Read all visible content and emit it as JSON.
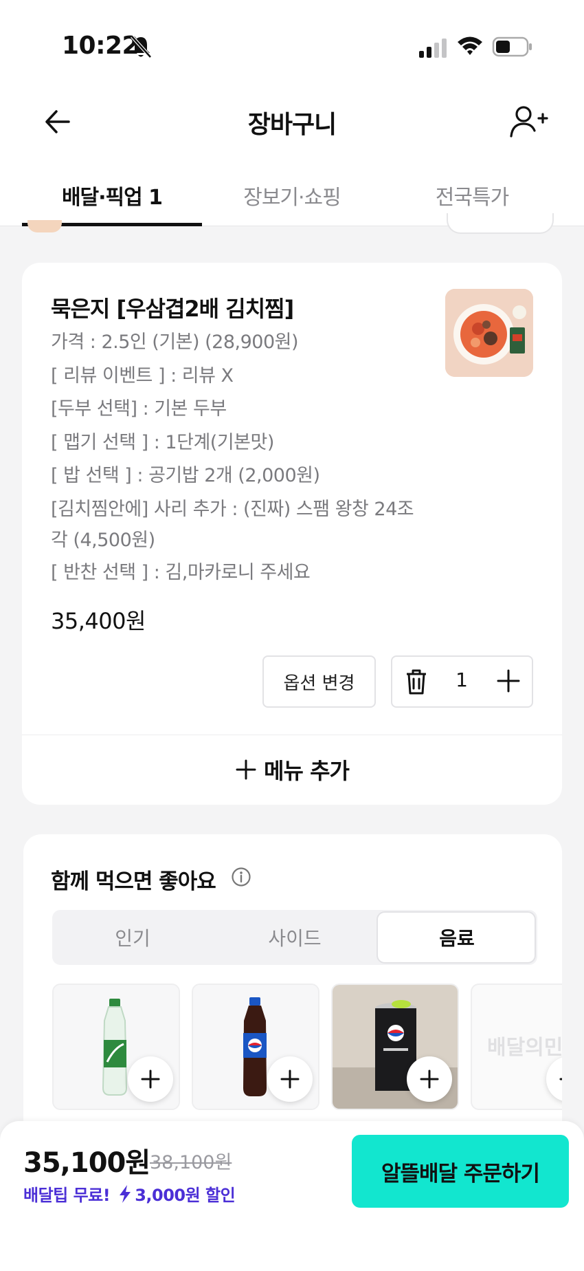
{
  "status_bar": {
    "time": "10:22"
  },
  "header": {
    "title": "장바구니",
    "back_icon": "arrow-left-icon",
    "add_user_icon": "person-add-icon"
  },
  "tabs": [
    {
      "label": "배달·픽업 1",
      "active": true
    },
    {
      "label": "장보기·쇼핑",
      "active": false
    },
    {
      "label": "전국특가",
      "active": false
    }
  ],
  "cart_item": {
    "name": "묵은지 [우삼겹2배 김치찜]",
    "options": [
      "가격 : 2.5인 (기본) (28,900원)",
      "[ 리뷰 이벤트 ] : 리뷰 X",
      "[두부 선택] : 기본 두부",
      "[ 맵기 선택 ] : 1단계(기본맛)",
      "[ 밥 선택 ] : 공기밥 2개 (2,000원)",
      "[김치찜안에] 사리 추가 : (진짜) 스팸 왕창 24조",
      "각 (4,500원)",
      "[ 반찬 선택 ] : 김,마카로니 주세요"
    ],
    "price": "35,400원",
    "change_option_label": "옵션 변경",
    "quantity": "1",
    "add_menu_label": "메뉴 추가"
  },
  "recommend": {
    "title": "함께 먹으면 좋아요",
    "segments": [
      {
        "label": "인기",
        "active": false
      },
      {
        "label": "사이드",
        "active": false
      },
      {
        "label": "음료",
        "active": true
      }
    ],
    "products": [
      {
        "icon": "chilsung-cider-bottle-icon"
      },
      {
        "icon": "pepsi-bottle-icon"
      },
      {
        "icon": "pepsi-zero-can-icon"
      },
      {
        "icon": "placeholder-logo-icon",
        "placeholder_text": "배달의민족"
      }
    ]
  },
  "bottom_bar": {
    "total": "35,100원",
    "original": "38,100원",
    "free_delivery": "배달팁 무료!",
    "discount": "3,000원 할인",
    "order_label": "알뜰배달 주문하기",
    "accent_color": "#12e6cf",
    "promo_color": "#4b2fd6"
  }
}
